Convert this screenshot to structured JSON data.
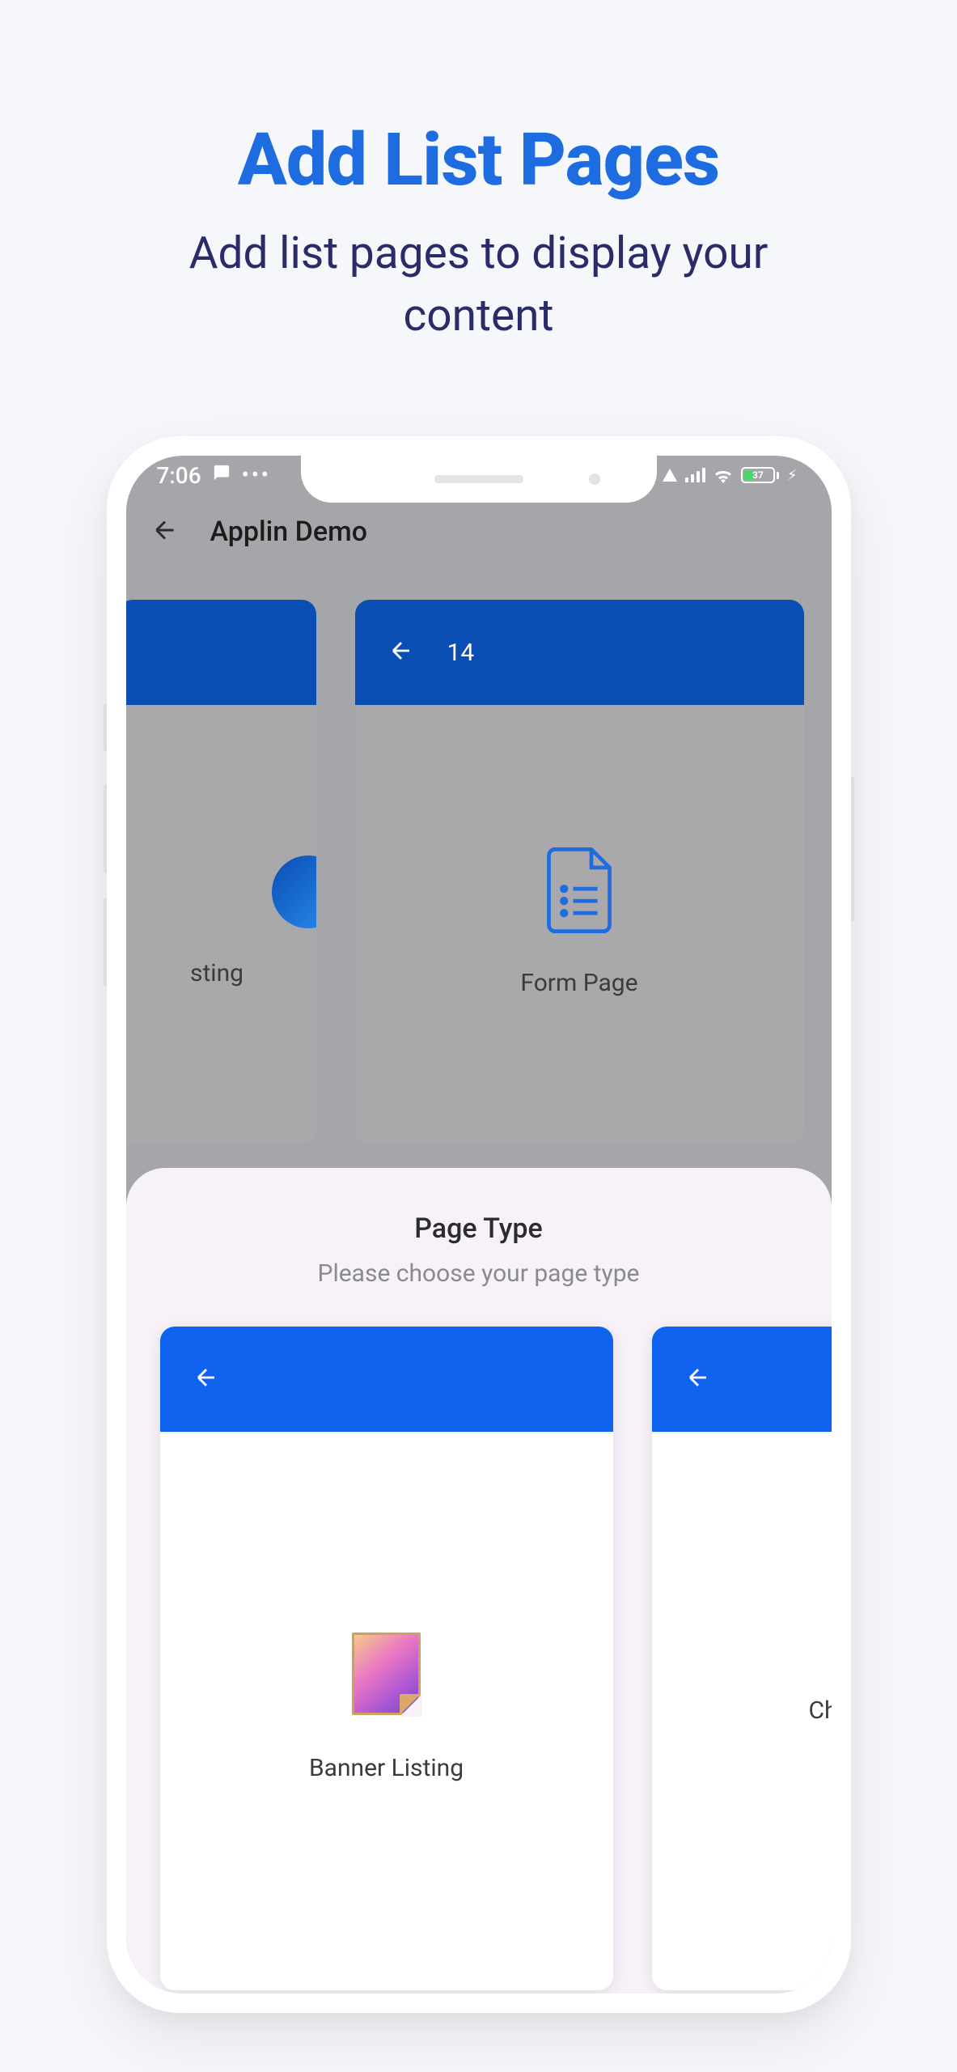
{
  "header": {
    "title": "Add List Pages",
    "subtitle": "Add list pages to display your content"
  },
  "statusBar": {
    "time": "7:06",
    "batteryPercent": "37"
  },
  "appBar": {
    "title": "Applin Demo"
  },
  "bgCards": {
    "leftPartialLabel": "sting",
    "rightHeaderNumber": "14",
    "rightLabel": "Form Page"
  },
  "sheet": {
    "title": "Page Type",
    "subtitle": "Please choose your page type",
    "cards": {
      "first": "Banner Listing",
      "secondPartial": "Ch"
    }
  }
}
